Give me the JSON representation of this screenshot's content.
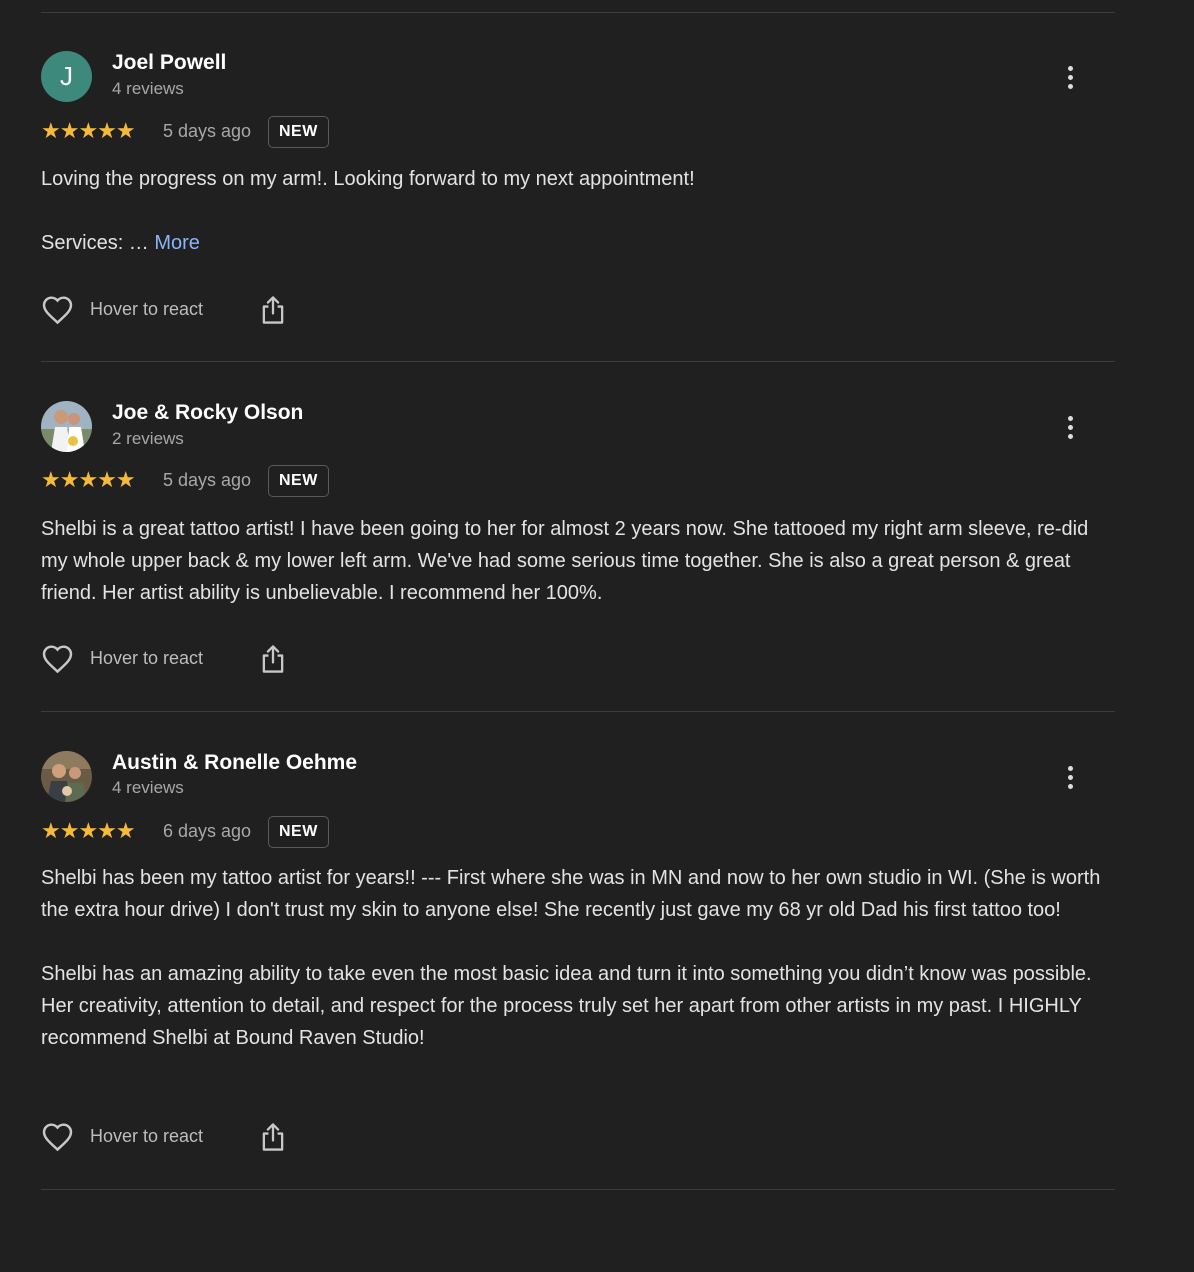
{
  "reviews": [
    {
      "name": "Joel Powell",
      "count": "4 reviews",
      "avatar_letter": "J",
      "stars": "★★★★★",
      "date": "5 days ago",
      "badge": "NEW",
      "paragraphs": [
        "Loving the progress on my arm!. Looking forward to my next appointment!"
      ],
      "services_prefix": "Services: … ",
      "more_label": "More",
      "react_label": "Hover to react"
    },
    {
      "name": "Joe & Rocky Olson",
      "count": "2 reviews",
      "stars": "★★★★★",
      "date": "5 days ago",
      "badge": "NEW",
      "paragraphs": [
        "Shelbi is a great tattoo artist! I have been going to her for almost 2 years now. She tattooed my right arm sleeve, re-did my whole upper back & my lower left arm. We've had some serious time together. She is also a great person & great friend. Her artist ability is unbelievable. I recommend her 100%."
      ],
      "react_label": "Hover to react"
    },
    {
      "name": "Austin & Ronelle Oehme",
      "count": "4 reviews",
      "stars": "★★★★★",
      "date": "6 days ago",
      "badge": "NEW",
      "paragraphs": [
        "Shelbi has been my tattoo artist for years!! --- First where she was in MN and now to her own studio in WI. (She is worth the extra hour drive) I don't trust my skin to anyone else! She recently just gave my 68 yr old Dad his first tattoo too!",
        "Shelbi has an amazing ability to take even the most basic idea and turn it into something you didn’t know was possible. Her creativity, attention to detail, and respect for the process truly set her apart from other artists in my past. I HIGHLY recommend Shelbi at Bound Raven Studio!"
      ],
      "react_label": "Hover to react"
    }
  ],
  "colors": {
    "background": "#202020",
    "star": "#f6b93b",
    "link": "#8ab4f8",
    "avatar_teal": "#3d8a7d"
  },
  "icons": [
    "kebab-menu-icon",
    "heart-outline-icon",
    "share-icon"
  ]
}
